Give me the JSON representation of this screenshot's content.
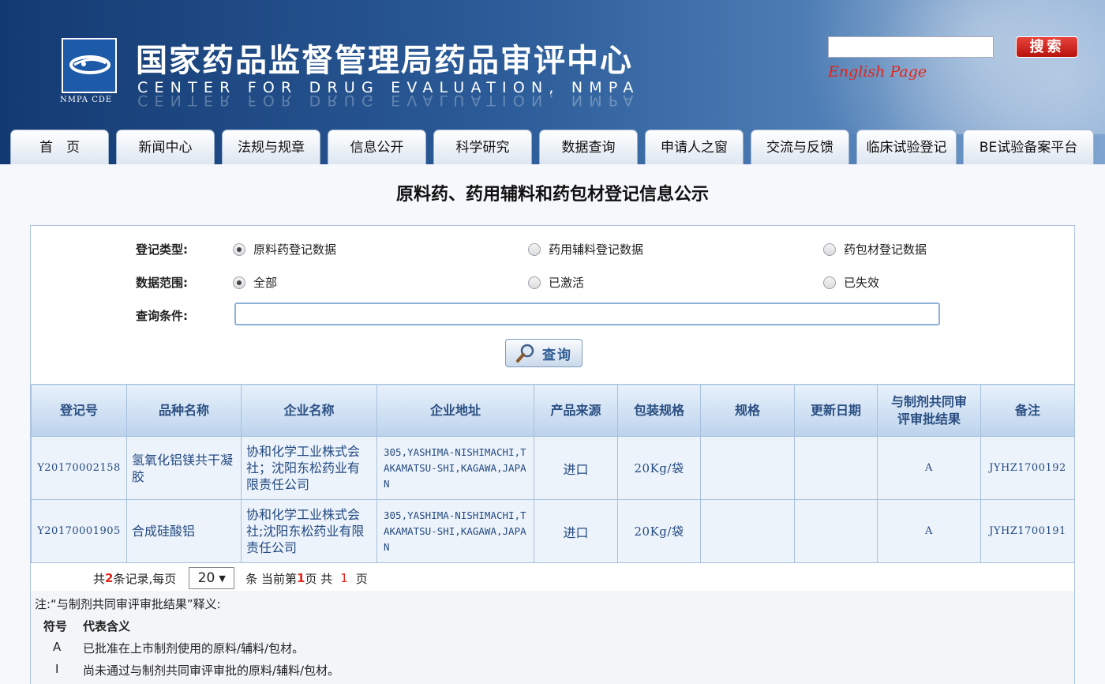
{
  "header": {
    "logo_caption": "NMPA CDE",
    "title_cn": "国家药品监督管理局药品审评中心",
    "title_en": "CENTER FOR DRUG EVALUATION, NMPA",
    "search_placeholder": "",
    "search_button": "搜索",
    "english_link": "English Page"
  },
  "nav": {
    "tabs": [
      "首　页",
      "新闻中心",
      "法规与规章",
      "信息公开",
      "科学研究",
      "数据查询",
      "申请人之窗",
      "交流与反馈",
      "临床试验登记",
      "BE试验备案平台"
    ]
  },
  "page_title": "原料药、药用辅料和药包材登记信息公示",
  "form": {
    "type_label": "登记类型:",
    "type_options": [
      "原料药登记数据",
      "药用辅料登记数据",
      "药包材登记数据"
    ],
    "type_selected": 0,
    "scope_label": "数据范围:",
    "scope_options": [
      "全部",
      "已激活",
      "已失效"
    ],
    "scope_selected": 0,
    "query_label": "查询条件:",
    "query_value": "",
    "query_button": "查询"
  },
  "table": {
    "headers": [
      "登记号",
      "品种名称",
      "企业名称",
      "企业地址",
      "产品来源",
      "包装规格",
      "规格",
      "更新日期",
      "与制剂共同审评审批结果",
      "备注"
    ],
    "rows": [
      [
        "Y20170002158",
        "氢氧化铝镁共干凝胶",
        "协和化学工业株式会社；沈阳东松药业有限责任公司",
        "305,YASHIMA-NISHIMACHI,TAKAMATSU-SHI,KAGAWA,JAPAN",
        "进口",
        "20Kg/袋",
        "",
        "",
        "A",
        "JYHZ1700192"
      ],
      [
        "Y20170001905",
        "合成硅酸铝",
        "协和化学工业株式会社;沈阳东松药业有限责任公司",
        "305,YASHIMA-NISHIMACHI,TAKAMATSU-SHI,KAGAWA,JAPAN",
        "进口",
        "20Kg/袋",
        "",
        "",
        "A",
        "JYHZ1700191"
      ]
    ]
  },
  "pager": {
    "prefix": "共",
    "total": "2",
    "records_per": "条记录,每页",
    "page_size": "20",
    "current_prefix": "条 当前第",
    "current": "1",
    "total_pages_prefix": "页 共",
    "total_pages": "1",
    "suffix": "页"
  },
  "notes": {
    "head": "注:“与制剂共同审评审批结果”释义:",
    "symbol_label": "符号",
    "meaning_label": "代表含义",
    "items": [
      {
        "symbol": "A",
        "meaning": "已批准在上市制剂使用的原料/辅料/包材。"
      },
      {
        "symbol": "I",
        "meaning": "尚未通过与制剂共同审评审批的原料/辅料/包材。"
      }
    ]
  }
}
